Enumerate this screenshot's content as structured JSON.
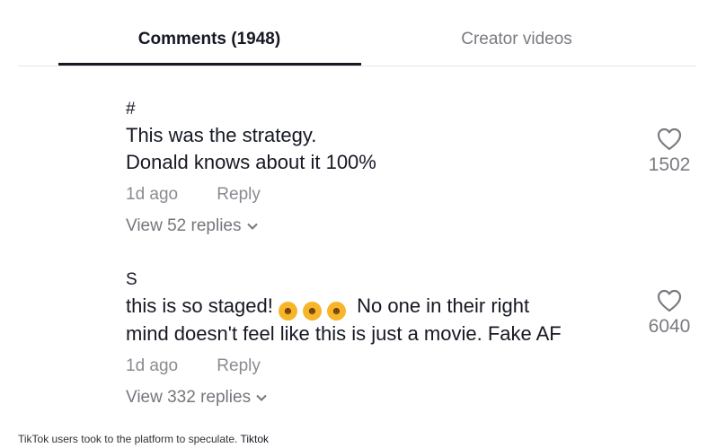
{
  "tabs": {
    "comments": "Comments (1948)",
    "creator": "Creator videos"
  },
  "comments": [
    {
      "username": "#",
      "line1": "This was the strategy.",
      "line2": "Donald knows about it 100%",
      "date": "1d ago",
      "reply": "Reply",
      "view_replies": "View 52 replies",
      "likes": "1502"
    },
    {
      "username": "S",
      "line1_prefix": "this is so staged!",
      "line1_suffix": "No one in their right",
      "line2": "mind doesn't feel like this is just a movie. Fake AF",
      "emojis": [
        "face-with-tears-of-joy",
        "face-with-tears-of-joy",
        "face-with-tears-of-joy"
      ],
      "date": "1d ago",
      "reply": "Reply",
      "view_replies": "View 332 replies",
      "likes": "6040"
    }
  ],
  "caption": {
    "text": "TikTok users took to the platform to speculate.",
    "source": "Tiktok"
  },
  "colors": {
    "primary_text": "#161823",
    "secondary_text": "#8a8b91",
    "divider": "#e6e6e8"
  }
}
